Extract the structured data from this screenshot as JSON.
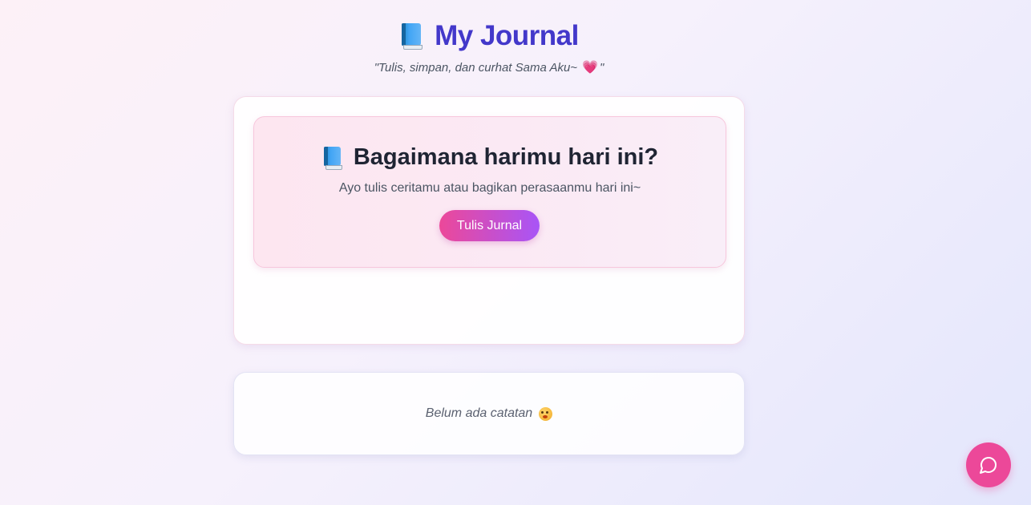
{
  "header": {
    "book_icon": "blue-book-icon",
    "title": "My Journal",
    "subtitle_quote_open": "\"Tulis, simpan, dan curhat Sama Aku~",
    "heart": "💗",
    "subtitle_quote_close": "\""
  },
  "prompt": {
    "icon": "blue-book-icon",
    "title": "Bagaimana harimu hari ini?",
    "subtitle": "Ayo tulis ceritamu atau bagikan perasaanmu hari ini~",
    "button_label": "Tulis Jurnal"
  },
  "entries": {
    "empty_text": "Belum ada catatan",
    "empty_icon": "flushed-face-icon"
  },
  "chat_button": {
    "icon": "chat-bubble-icon"
  },
  "colors": {
    "accent_title": "#4338ca",
    "button_gradient_start": "#ec4899",
    "button_gradient_end": "#a855f7",
    "fab": "#ec4899"
  }
}
